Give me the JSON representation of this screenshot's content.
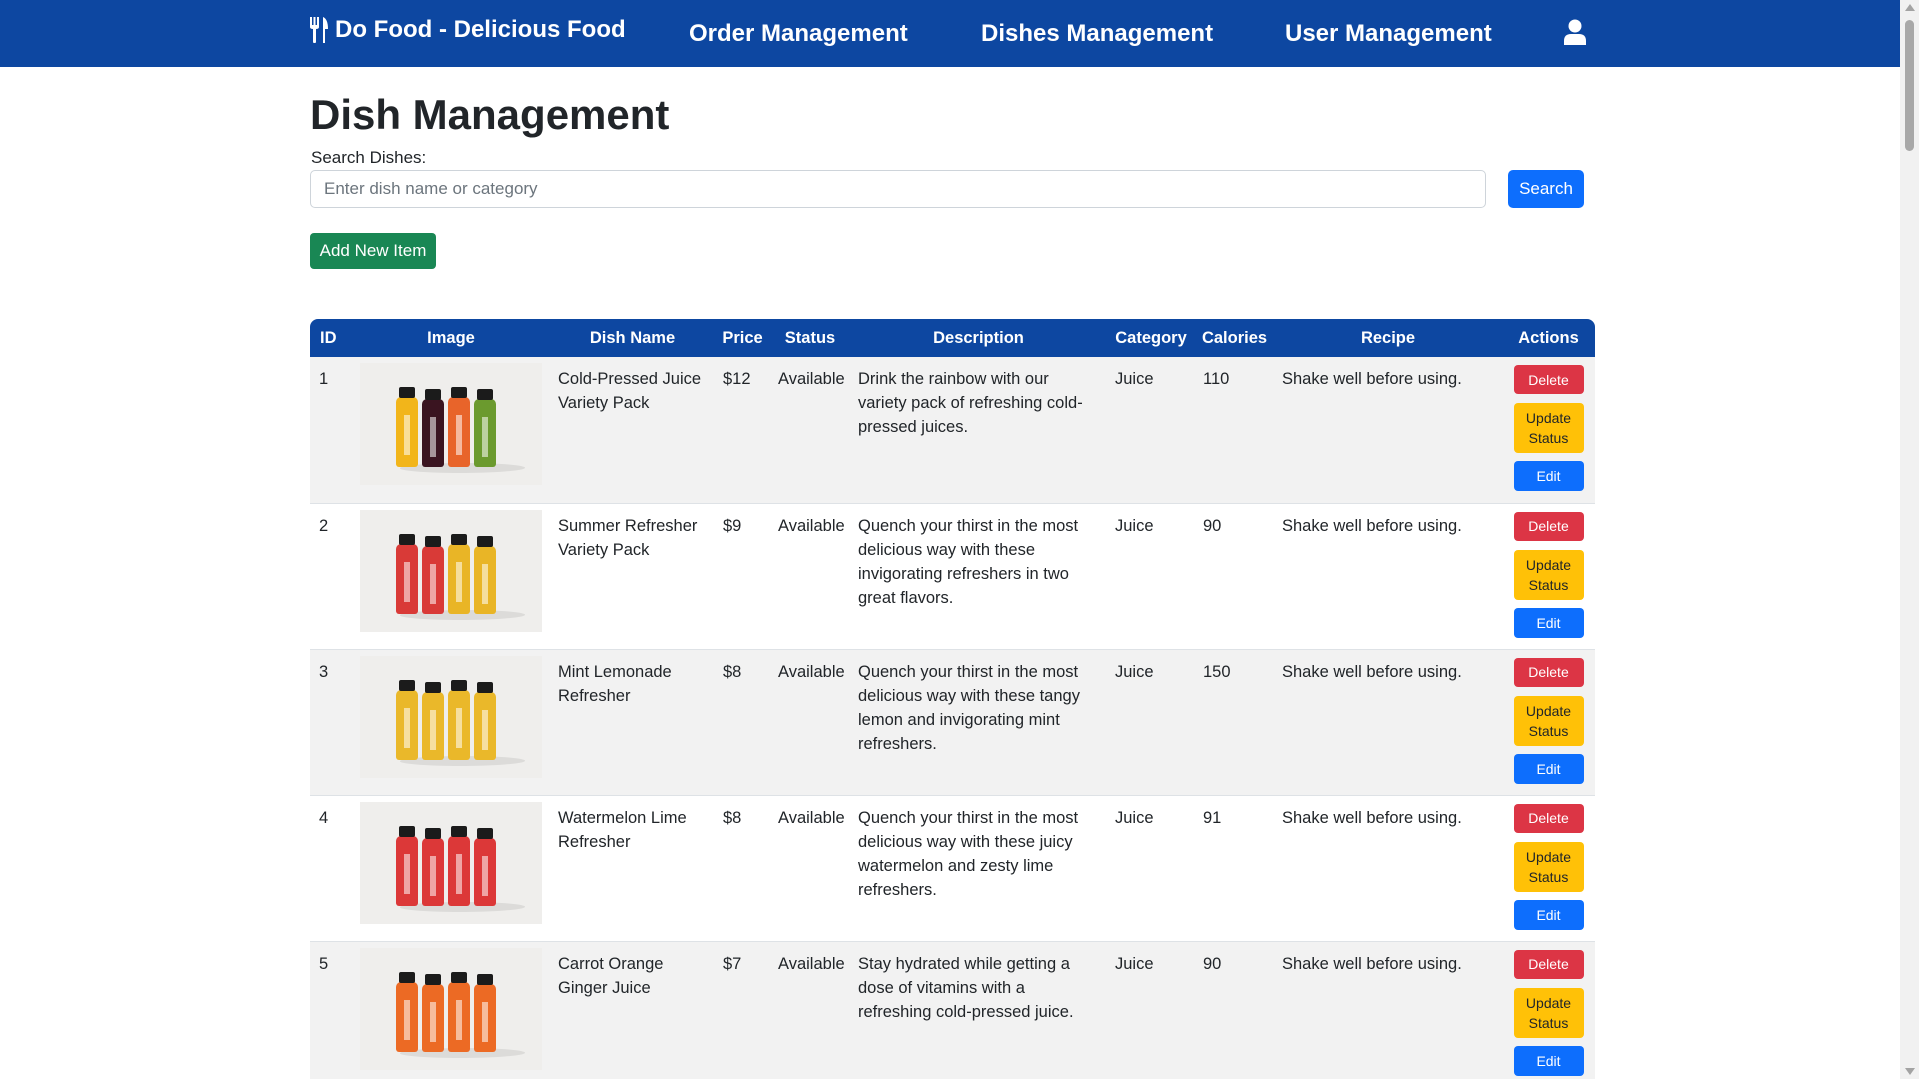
{
  "nav": {
    "brand": "Do Food - Delicious Food",
    "links": [
      "Order Management",
      "Dishes Management",
      "User Management"
    ]
  },
  "page": {
    "title": "Dish Management",
    "search_label": "Search Dishes:",
    "search_placeholder": "Enter dish name or category",
    "search_value": "",
    "search_button": "Search",
    "add_button": "Add New Item"
  },
  "table": {
    "headers": [
      "ID",
      "Image",
      "Dish Name",
      "Price",
      "Status",
      "Description",
      "Category",
      "Calories",
      "Recipe",
      "Actions"
    ],
    "action_labels": {
      "delete": "Delete",
      "update_status": "Update Status",
      "edit": "Edit"
    },
    "rows": [
      {
        "id": "1",
        "name": "Cold-Pressed Juice Variety Pack",
        "price": "$12",
        "status": "Available",
        "description": "Drink the rainbow with our variety pack of refreshing cold-pressed juices.",
        "category": "Juice",
        "calories": "110",
        "recipe": "Shake well before using.",
        "bottle_colors": [
          "#f2b51a",
          "#3a1420",
          "#e8642a",
          "#6b9a2e"
        ]
      },
      {
        "id": "2",
        "name": "Summer Refresher Variety Pack",
        "price": "$9",
        "status": "Available",
        "description": "Quench your thirst in the most delicious way with these invigorating refreshers in two great flavors.",
        "category": "Juice",
        "calories": "90",
        "recipe": "Shake well before using.",
        "bottle_colors": [
          "#d93a37",
          "#d93a37",
          "#e9b526",
          "#e9b526"
        ]
      },
      {
        "id": "3",
        "name": "Mint Lemonade Refresher",
        "price": "$8",
        "status": "Available",
        "description": "Quench your thirst in the most delicious way with these tangy lemon and invigorating mint refreshers.",
        "category": "Juice",
        "calories": "150",
        "recipe": "Shake well before using.",
        "bottle_colors": [
          "#eab82a",
          "#eab82a",
          "#eab82a",
          "#eab82a"
        ]
      },
      {
        "id": "4",
        "name": "Watermelon Lime Refresher",
        "price": "$8",
        "status": "Available",
        "description": "Quench your thirst in the most delicious way with these juicy watermelon and zesty lime refreshers.",
        "category": "Juice",
        "calories": "91",
        "recipe": "Shake well before using.",
        "bottle_colors": [
          "#dc3838",
          "#dc3838",
          "#dc3838",
          "#dc3838"
        ]
      },
      {
        "id": "5",
        "name": "Carrot Orange Ginger Juice",
        "price": "$7",
        "status": "Available",
        "description": "Stay hydrated while getting a dose of vitamins with a refreshing cold-pressed juice.",
        "category": "Juice",
        "calories": "90",
        "recipe": "Shake well before using.",
        "bottle_colors": [
          "#ec6a24",
          "#ec6a24",
          "#ec6a24",
          "#ec6a24"
        ]
      }
    ]
  }
}
